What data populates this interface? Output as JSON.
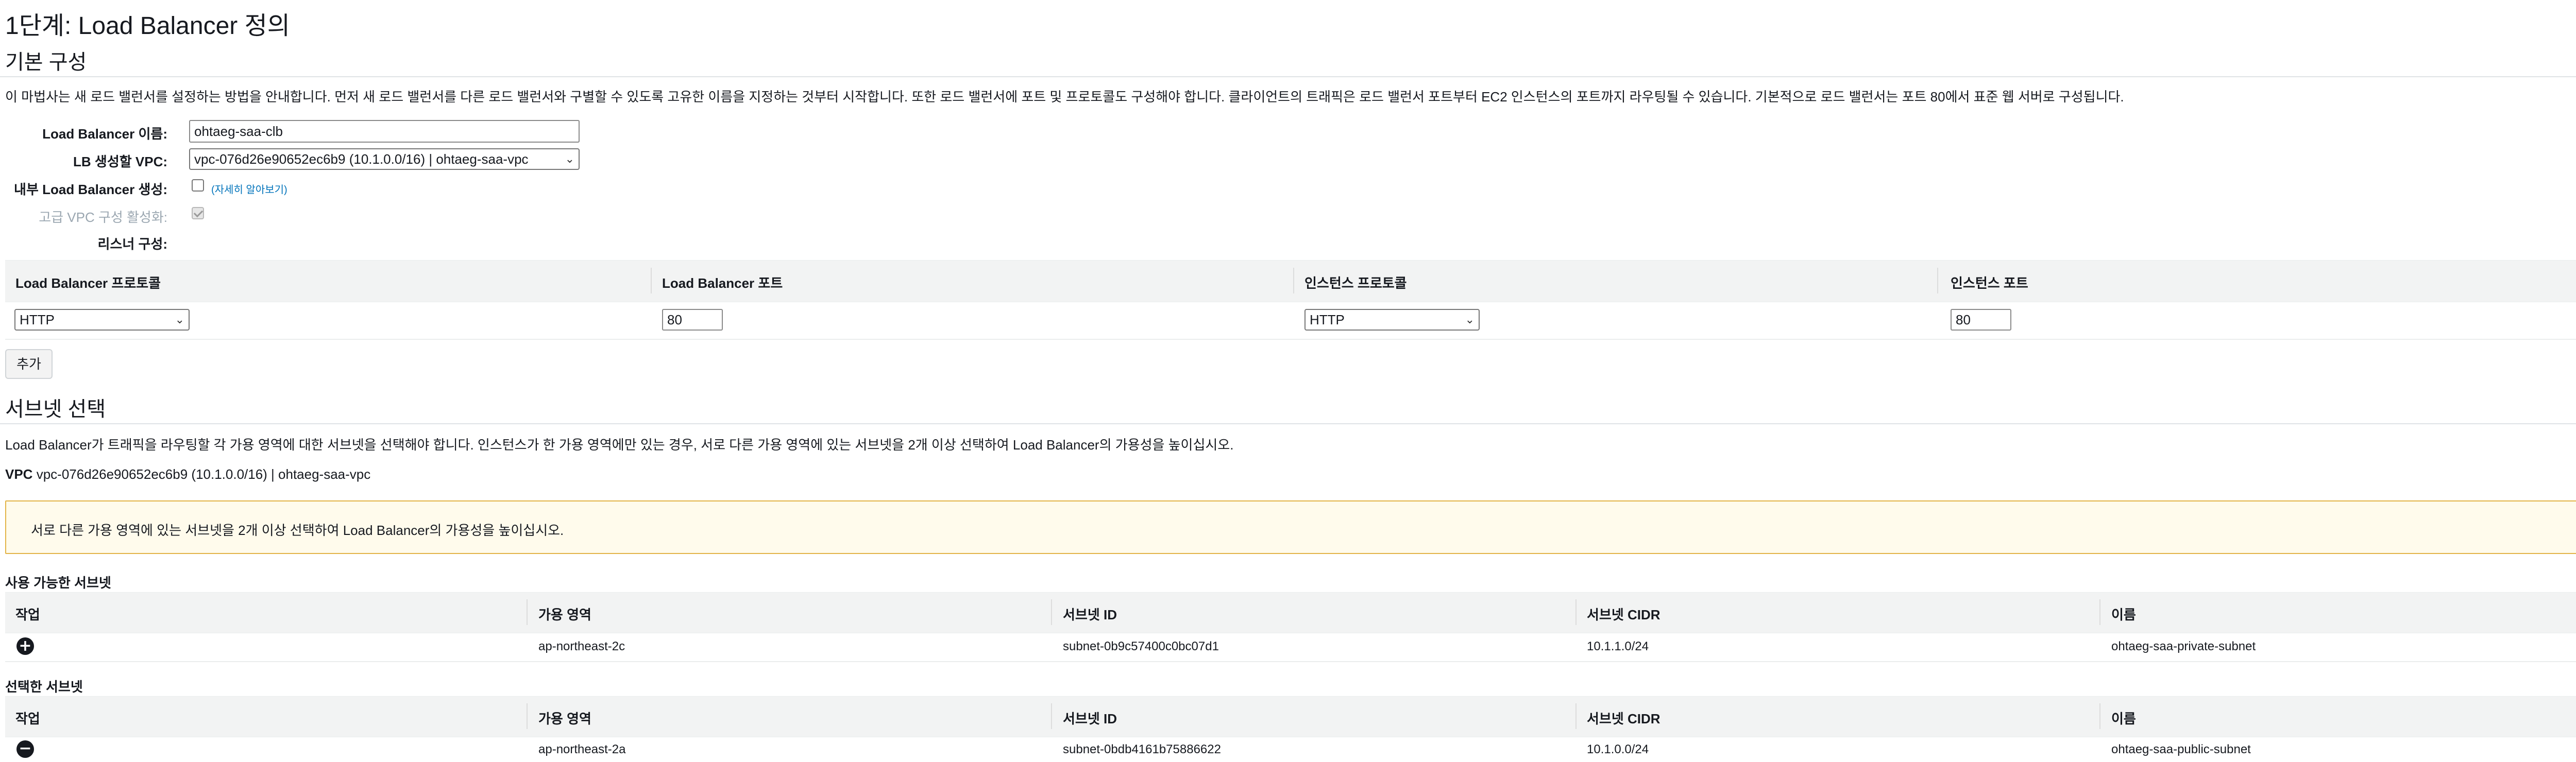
{
  "page": {
    "title": "1단계: Load Balancer 정의"
  },
  "basic_config": {
    "heading": "기본 구성",
    "description": "이 마법사는 새 로드 밸런서를 설정하는 방법을 안내합니다. 먼저 새 로드 밸런서를 다른 로드 밸런서와 구별할 수 있도록 고유한 이름을 지정하는 것부터 시작합니다. 또한 로드 밸런서에 포트 및 프로토콜도 구성해야 합니다. 클라이언트의 트래픽은 로드 밸런서 포트부터 EC2 인스턴스의 포트까지 라우팅될 수 있습니다. 기본적으로 로드 밸런서는 포트 80에서 표준 웹 서버로 구성됩니다.",
    "name_label": "Load Balancer 이름:",
    "name_value": "ohtaeg-saa-clb",
    "vpc_label": "LB 생성할 VPC:",
    "vpc_value": "vpc-076d26e90652ec6b9 (10.1.0.0/16) | ohtaeg-saa-vpc",
    "internal_label": "내부 Load Balancer 생성:",
    "internal_link": "(자세히 알아보기)",
    "advanced_vpc_label": "고급 VPC 구성 활성화:",
    "listener_label": "리스너 구성:"
  },
  "listener_table": {
    "headers": [
      "Load Balancer 프로토콜",
      "Load Balancer 포트",
      "인스턴스 프로토콜",
      "인스턴스 포트"
    ],
    "row": {
      "lb_protocol": "HTTP",
      "lb_port": "80",
      "instance_protocol": "HTTP",
      "instance_port": "80"
    },
    "add_button": "추가",
    "remove_icon": "close-circle-icon"
  },
  "subnet_section": {
    "heading": "서브넷 선택",
    "description": "Load Balancer가 트래픽을 라우팅할 각 가용 영역에 대한 서브넷을 선택해야 합니다. 인스턴스가 한 가용 영역에만 있는 경우, 서로 다른 가용 영역에 있는 서브넷을 2개 이상 선택하여 Load Balancer의 가용성을 높이십시오.",
    "vpc_label": "VPC",
    "vpc_value": "vpc-076d26e90652ec6b9 (10.1.0.0/16) | ohtaeg-saa-vpc",
    "warning": "서로 다른 가용 영역에 있는 서브넷을 2개 이상 선택하여 Load Balancer의 가용성을 높이십시오.",
    "available_heading": "사용 가능한 서브넷",
    "selected_heading": "선택한 서브넷",
    "columns": [
      "작업",
      "가용 영역",
      "서브넷 ID",
      "서브넷 CIDR",
      "이름"
    ],
    "available_rows": [
      {
        "action_icon": "plus-circle-icon",
        "az": "ap-northeast-2c",
        "subnet_id": "subnet-0b9c57400c0bc07d1",
        "cidr": "10.1.1.0/24",
        "name": "ohtaeg-saa-private-subnet"
      }
    ],
    "selected_rows": [
      {
        "action_icon": "minus-circle-icon",
        "az": "ap-northeast-2a",
        "subnet_id": "subnet-0bdb4161b75886622",
        "cidr": "10.1.0.0/24",
        "name": "ohtaeg-saa-public-subnet"
      }
    ]
  },
  "colors": {
    "link": "#0073bb",
    "header_bg": "#f2f3f3",
    "warning_border": "#e3b448",
    "warning_bg": "#fffbec"
  }
}
